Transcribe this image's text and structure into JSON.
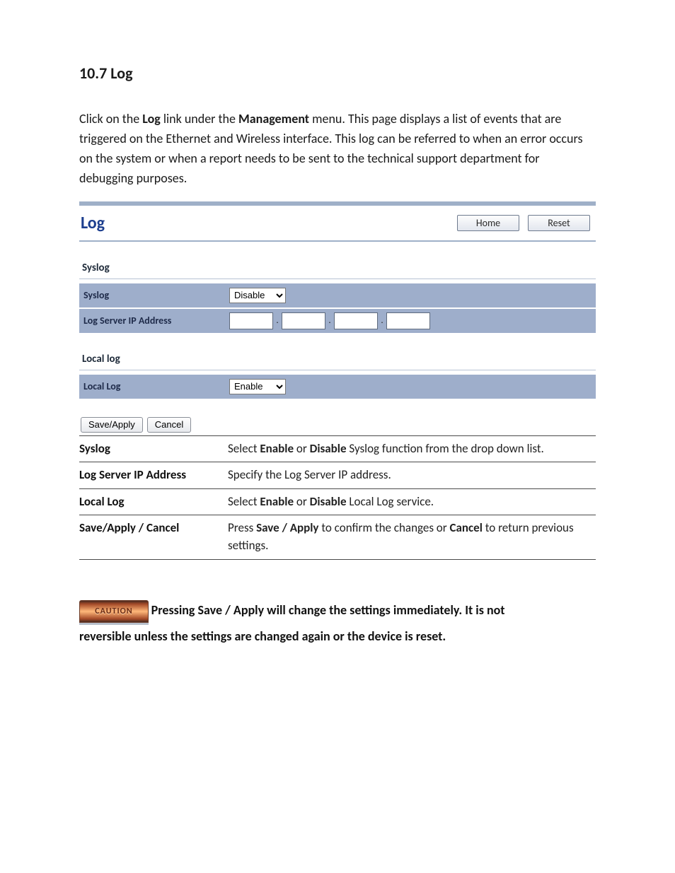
{
  "doc": {
    "heading": "10.7 Log",
    "intro_pre": "Click on the ",
    "intro_link": "Log",
    "intro_mid": " link under the ",
    "intro_menu": "Management",
    "intro_post": " menu. This page displays a list of events that are triggered on the Ethernet and Wireless interface. This log can be referred to when an error occurs on the system or when a report needs to be sent to the technical support department for debugging purposes."
  },
  "ui": {
    "title": "Log",
    "home_btn": "Home",
    "reset_btn": "Reset",
    "syslog_section": "Syslog",
    "syslog_label": "Syslog",
    "syslog_value": "Disable",
    "logserver_label": "Log Server IP Address",
    "ip_dot": ".",
    "locallog_section": "Local log",
    "locallog_label": "Local Log",
    "locallog_value": "Enable",
    "save_btn": "Save/Apply",
    "cancel_btn": "Cancel"
  },
  "params": {
    "syslog_label": "Syslog",
    "syslog_pre": "Select ",
    "syslog_b1": "Enable",
    "syslog_mid": " or ",
    "syslog_b2": "Disable",
    "syslog_post": " Syslog function from the drop down list.",
    "logserver_label": "Log Server IP Address",
    "logserver_desc": "Specify the Log Server IP address.",
    "locallog_label": "Local Log",
    "locallog_pre": "Select ",
    "locallog_b1": "Enable",
    "locallog_mid": " or ",
    "locallog_b2": "Disable",
    "locallog_post": " Local Log service.",
    "save_label": "Save/Apply / Cancel",
    "save_pre": "Press ",
    "save_b1": "Save / Apply",
    "save_mid": " to confirm the changes or ",
    "save_b2": "Cancel",
    "save_post": " to return previous settings."
  },
  "caution": {
    "badge": "CAUTION",
    "line1": " Pressing Save / Apply will change the settings immediately. It is not",
    "line2": "reversible unless the settings are changed again or the device is reset."
  }
}
